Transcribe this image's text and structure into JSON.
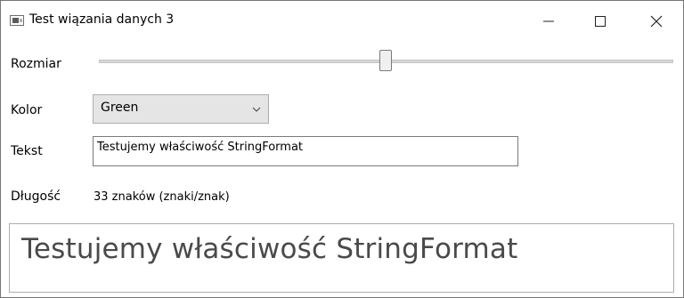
{
  "window": {
    "title": "Test wiązania danych 3",
    "controls": {
      "minimize": "minimize-icon",
      "maximize": "maximize-icon",
      "close": "close-icon"
    }
  },
  "size_row": {
    "label": "Rozmiar",
    "slider_value_fraction": 0.5
  },
  "color_row": {
    "label": "Kolor",
    "selected": "Green"
  },
  "text_row": {
    "label": "Tekst",
    "value": "Testujemy właściwość StringFormat"
  },
  "length_row": {
    "label": "Długość",
    "value": "33 znaków (znaki/znak)"
  },
  "preview": {
    "text": "Testujemy właściwość StringFormat",
    "color": "#4a4a4a"
  }
}
